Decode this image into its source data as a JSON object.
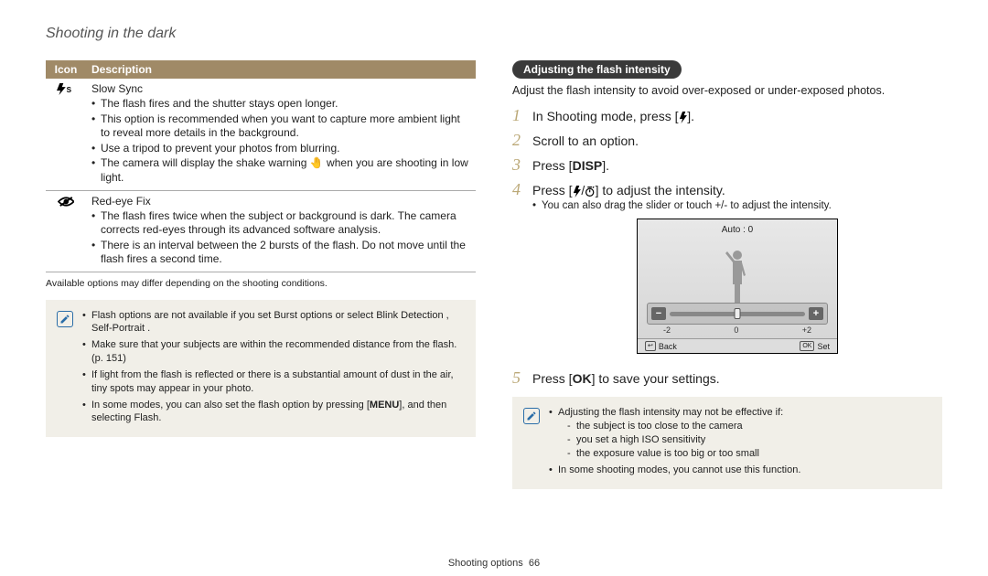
{
  "page": {
    "title": "Shooting in the dark",
    "footer_section": "Shooting options",
    "footer_page": "66"
  },
  "table": {
    "head_icon": "Icon",
    "head_desc": "Description",
    "rows": [
      {
        "title": "Slow Sync",
        "bullets": [
          "The flash fires and the shutter stays open longer.",
          "This option is recommended when you want to capture more ambient light to reveal more details in the background.",
          "Use a tripod to prevent your photos from blurring.",
          "The camera will display the shake warning 🤚 when you are shooting in low light."
        ]
      },
      {
        "title": "Red-eye Fix",
        "bullets": [
          "The flash fires twice when the subject or background is dark. The camera corrects red-eyes through its advanced software analysis.",
          "There is an interval between the 2 bursts of the flash. Do not move until the flash fires a second time."
        ]
      }
    ],
    "footnote": "Available options may differ depending on the shooting conditions."
  },
  "left_note": {
    "items": [
      "Flash options are not available if you set Burst options or select Blink Detection , Self-Portrait .",
      "Make sure that your subjects are within the recommended distance from the flash. (p. 151)",
      "If light from the flash is reflected or there is a substantial amount of dust in the air, tiny spots may appear in your photo.",
      "In some modes, you can also set the flash option by pressing [MENU], and then selecting Flash."
    ]
  },
  "right": {
    "pill": "Adjusting the flash intensity",
    "intro": "Adjust the flash intensity to avoid over-exposed or under-exposed photos.",
    "steps": {
      "s1": "In Shooting mode, press [",
      "s1b": "].",
      "s2": "Scroll to an option.",
      "s3a": "Press [",
      "s3b": "].",
      "s4a": "Press [",
      "s4b": "/",
      "s4c": "] to adjust the intensity.",
      "s4_sub": "You can also drag the slider or touch +/- to adjust the intensity.",
      "s5a": "Press [",
      "s5b": "] to save your settings."
    },
    "screen": {
      "title": "Auto : 0",
      "minus": "−",
      "plus": "+",
      "scale_l": "-2",
      "scale_m": "0",
      "scale_r": "+2",
      "back": "Back",
      "set": "Set",
      "ok": "OK"
    }
  },
  "right_note": {
    "head": "Adjusting the flash intensity may not be effective if:",
    "subs": [
      "the subject is too close to the camera",
      "you set a high ISO sensitivity",
      "the exposure value is too big or too small"
    ],
    "last": "In some shooting modes, you cannot use this function."
  },
  "labels": {
    "disp": "DISP",
    "menu": "MENU",
    "ok": "OK"
  }
}
